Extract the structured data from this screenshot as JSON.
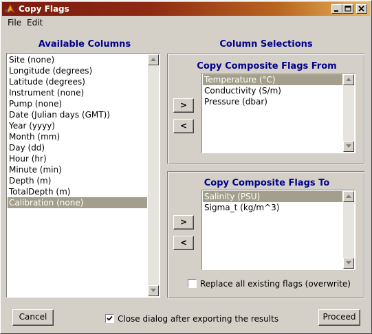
{
  "window": {
    "title": "Copy Flags"
  },
  "menu": [
    "File",
    "Edit"
  ],
  "available": {
    "heading": "Available Columns",
    "items": [
      "Site (none)",
      "Longitude (degrees)",
      "Latitude (degrees)",
      "Instrument (none)",
      "Pump (none)",
      "Date (Julian days (GMT))",
      "Year (yyyy)",
      "Month (mm)",
      "Day (dd)",
      "Hour (hr)",
      "Minute (min)",
      "Depth (m)",
      "TotalDepth (m)",
      "Calibration (none)"
    ],
    "selected_index": 13
  },
  "selections": {
    "heading": "Column Selections",
    "from": {
      "heading": "Copy Composite Flags From",
      "items": [
        "Temperature (°C)",
        "Conductivity (S/m)",
        "Pressure (dbar)"
      ],
      "selected_index": 0,
      "add_label": ">",
      "remove_label": "<"
    },
    "to": {
      "heading": "Copy Composite Flags To",
      "items": [
        "Salinity (PSU)",
        "Sigma_t (kg/m^3)"
      ],
      "selected_index": 0,
      "add_label": ">",
      "remove_label": "<",
      "overwrite_label": "Replace all existing flags (overwrite)",
      "overwrite_checked": false
    }
  },
  "footer": {
    "cancel_label": "Cancel",
    "close_label": "Close dialog after exporting the results",
    "close_checked": true,
    "proceed_label": "Proceed"
  }
}
